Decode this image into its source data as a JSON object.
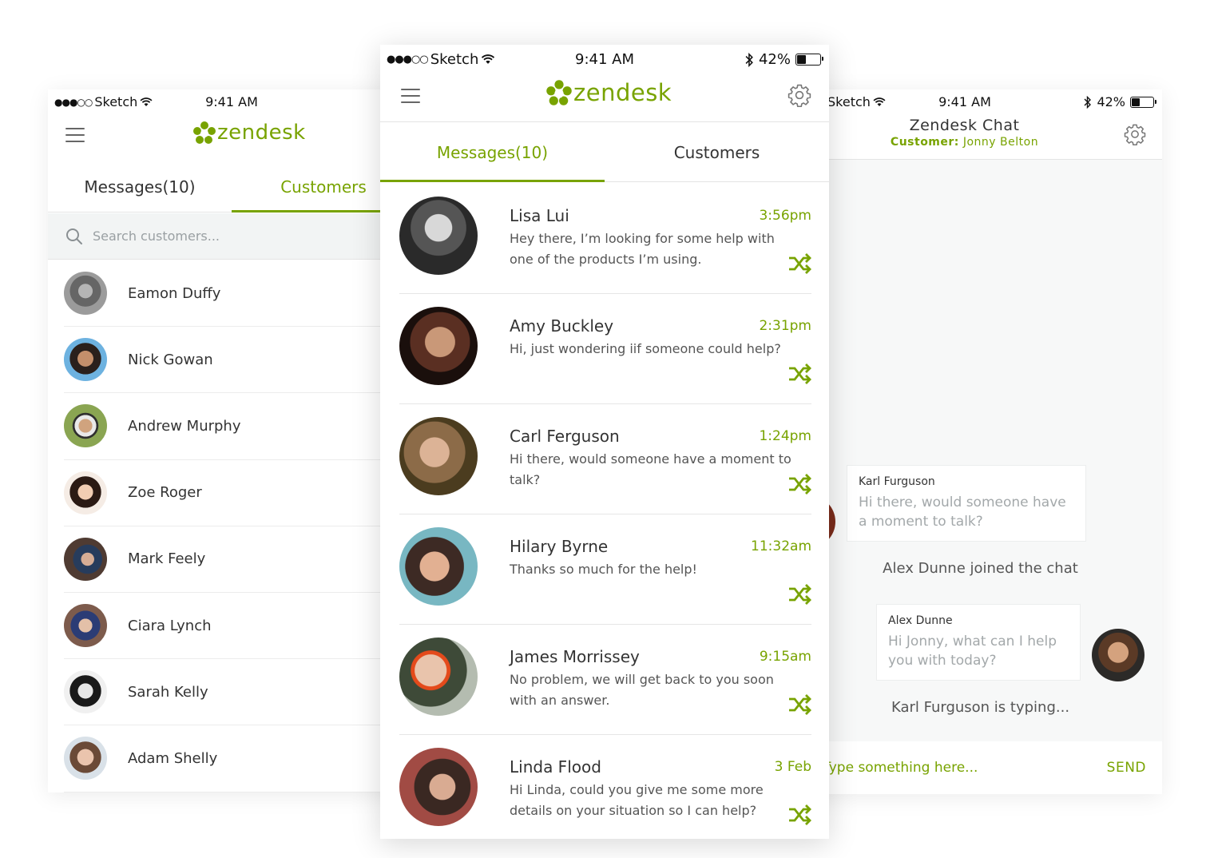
{
  "status_bar": {
    "carrier": "Sketch",
    "time": "9:41 AM",
    "battery": "42%",
    "battery_level": 0.42
  },
  "brand": {
    "logo_text": "zendesk",
    "accent_color": "#78a300"
  },
  "left": {
    "tabs": [
      {
        "label": "Messages(10)",
        "active": false
      },
      {
        "label": "Customers",
        "active": true
      }
    ],
    "search_placeholder": "Search customers...",
    "customers": [
      "Eamon Duffy",
      "Nick Gowan",
      "Andrew Murphy",
      "Zoe Roger",
      "Mark Feely",
      "Ciara Lynch",
      "Sarah Kelly",
      "Adam Shelly"
    ]
  },
  "center": {
    "tabs": [
      {
        "label": "Messages(10)",
        "active": true
      },
      {
        "label": "Customers",
        "active": false
      }
    ],
    "messages": [
      {
        "name": "Lisa Lui",
        "time": "3:56pm",
        "preview": "Hey there, I’m looking for some help with one of the products I’m using."
      },
      {
        "name": "Amy Buckley",
        "time": "2:31pm",
        "preview": "Hi, just wondering iif someone could help?"
      },
      {
        "name": "Carl Ferguson",
        "time": "1:24pm",
        "preview": "Hi there, would someone have a moment to talk?"
      },
      {
        "name": "Hilary Byrne",
        "time": "11:32am",
        "preview": "Thanks so much for the help!"
      },
      {
        "name": "James Morrissey",
        "time": "9:15am",
        "preview": "No problem, we will get back to you soon with an answer."
      },
      {
        "name": "Linda Flood",
        "time": "3 Feb",
        "preview": "Hi Linda, could you give me some more details on your situation so I can help?"
      }
    ]
  },
  "right": {
    "title": "Zendesk Chat",
    "customer_label": "Customer:",
    "customer_name": "Jonny Belton",
    "chat": [
      {
        "sender": "Karl Furguson",
        "text": "Hi there, would someone have a moment to talk?"
      },
      {
        "system": "Alex Dunne joined the chat"
      },
      {
        "sender": "Alex Dunne",
        "text": "Hi Jonny, what can I help you with today?"
      },
      {
        "system": "Karl Furguson is typing..."
      }
    ],
    "input_placeholder": "Type something here...",
    "send_label": "SEND"
  }
}
